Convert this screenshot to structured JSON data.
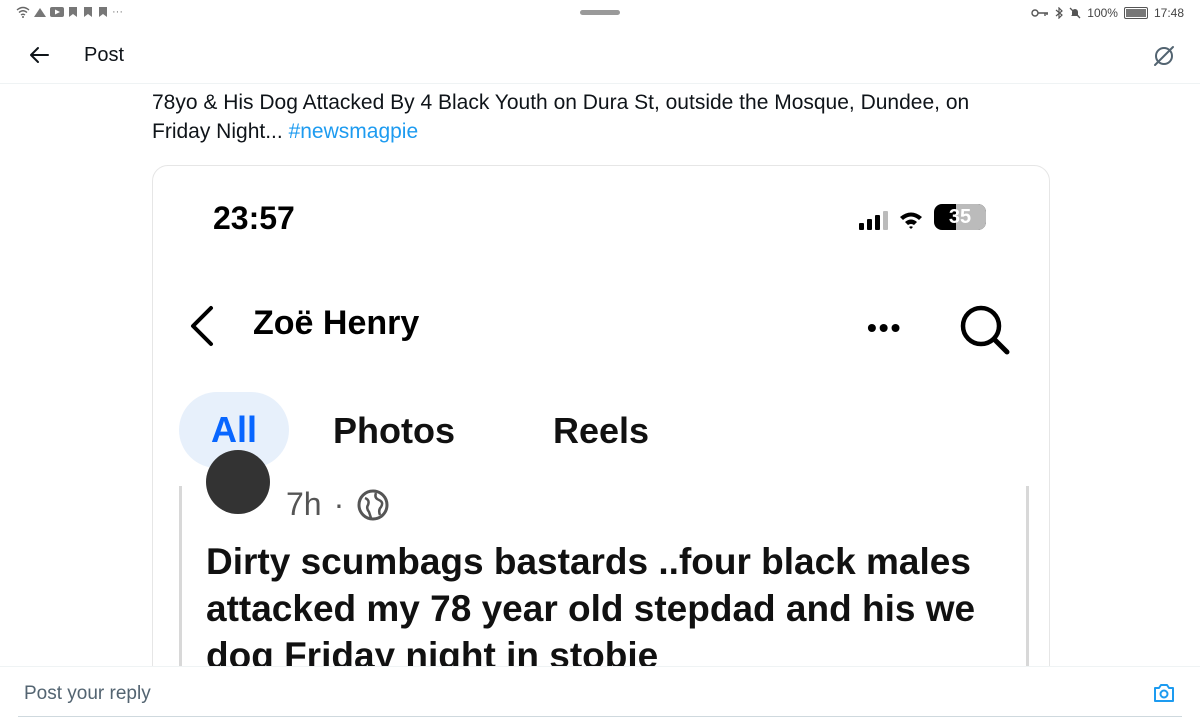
{
  "status_bar": {
    "battery": "100%",
    "time": "17:48"
  },
  "header": {
    "title": "Post"
  },
  "post": {
    "text": "78yo & His Dog Attacked By 4 Black Youth on Dura St, outside the Mosque, Dundee, on Friday Night...",
    "hashtag": "#newsmagpie"
  },
  "screenshot": {
    "phone_time": "23:57",
    "battery_level": "35",
    "profile_name": "Zoë Henry",
    "tabs": [
      "All",
      "Photos",
      "Reels"
    ],
    "post_age": "7h",
    "post_separator": "·",
    "post_body": "Dirty scumbags bastards ..four black males attacked my 78 year old stepdad and his we dog Friday night in stobie"
  },
  "reply": {
    "placeholder": "Post your reply"
  },
  "colors": {
    "accent": "#1d9bf0",
    "fb_blue": "#0866ff",
    "fb_tab_bg": "#e7f0fb"
  },
  "icons": {
    "back": "arrow-left-icon",
    "grok": "grok-icon",
    "camera": "camera-icon",
    "search": "search-icon",
    "globe": "globe-icon"
  }
}
